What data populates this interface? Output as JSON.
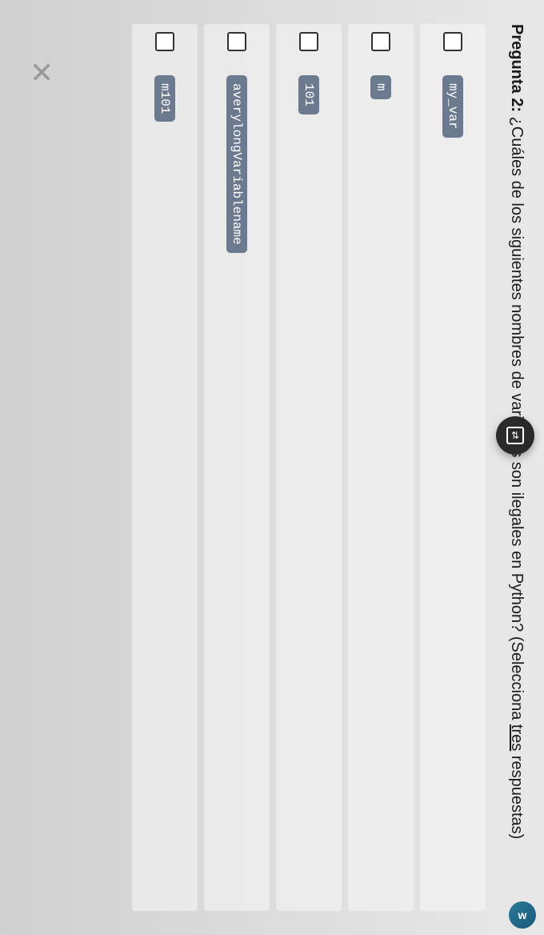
{
  "question": {
    "label": "Pregunta 2:",
    "text": " ¿Cuáles de los siguientes nombres de variables son ilegales en Python? ",
    "instruction_open": "(Selecciona ",
    "instruction_underline": "tres",
    "instruction_close": " respuestas)"
  },
  "options": [
    {
      "code": "my_var"
    },
    {
      "code": "m"
    },
    {
      "code": "101"
    },
    {
      "code": "averylongVariablename"
    },
    {
      "code": "m101"
    }
  ],
  "incorrect_mark": "✕",
  "float_arrows": "⇅",
  "badge_text": "w"
}
